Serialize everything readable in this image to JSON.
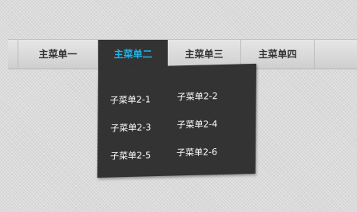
{
  "nav": {
    "items": [
      {
        "label": "主菜单一"
      },
      {
        "label": "主菜单二"
      },
      {
        "label": "主菜单三"
      },
      {
        "label": "主菜单四"
      }
    ],
    "active_index": 1,
    "active_color": "#1fb4e8"
  },
  "submenu": {
    "items": [
      {
        "label": "子菜单2-1"
      },
      {
        "label": "子菜单2-2"
      },
      {
        "label": "子菜单2-3"
      },
      {
        "label": "子菜单2-4"
      },
      {
        "label": "子菜单2-5"
      },
      {
        "label": "子菜单2-6"
      }
    ],
    "background": "#333333"
  }
}
